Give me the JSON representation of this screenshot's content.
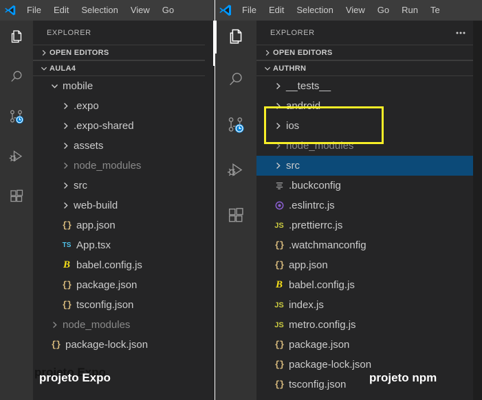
{
  "left_window": {
    "menubar": {
      "logo": "vscode-logo",
      "items": [
        "File",
        "Edit",
        "Selection",
        "View",
        "Go"
      ]
    },
    "activity_bar": {
      "items": [
        {
          "name": "explorer-icon",
          "label": "Explorer",
          "active": true
        },
        {
          "name": "search-icon",
          "label": "Search",
          "active": false
        },
        {
          "name": "source-control-icon",
          "label": "Source Control",
          "active": false
        },
        {
          "name": "run-debug-icon",
          "label": "Run and Debug",
          "active": false
        },
        {
          "name": "extensions-icon",
          "label": "Extensions",
          "active": false
        }
      ]
    },
    "sidebar": {
      "title": "EXPLORER",
      "open_editors": "OPEN EDITORS",
      "root": "AULA4",
      "tree": [
        {
          "label": "mobile",
          "indent": 1,
          "type": "folder",
          "expanded": true,
          "icon": "chevron-down-icon",
          "dim": false
        },
        {
          "label": ".expo",
          "indent": 2,
          "type": "folder",
          "expanded": false,
          "icon": "chevron-right-icon",
          "dim": false
        },
        {
          "label": ".expo-shared",
          "indent": 2,
          "type": "folder",
          "expanded": false,
          "icon": "chevron-right-icon",
          "dim": false
        },
        {
          "label": "assets",
          "indent": 2,
          "type": "folder",
          "expanded": false,
          "icon": "chevron-right-icon",
          "dim": false
        },
        {
          "label": "node_modules",
          "indent": 2,
          "type": "folder",
          "expanded": false,
          "icon": "chevron-right-icon",
          "dim": true
        },
        {
          "label": "src",
          "indent": 2,
          "type": "folder",
          "expanded": false,
          "icon": "chevron-right-icon",
          "dim": false
        },
        {
          "label": "web-build",
          "indent": 2,
          "type": "folder",
          "expanded": false,
          "icon": "chevron-right-icon",
          "dim": false
        },
        {
          "label": "app.json",
          "indent": 2,
          "type": "file",
          "icon": "json-icon",
          "glyph": "{}",
          "dim": false
        },
        {
          "label": "App.tsx",
          "indent": 2,
          "type": "file",
          "icon": "ts-icon",
          "glyph": "TS",
          "dim": false
        },
        {
          "label": "babel.config.js",
          "indent": 2,
          "type": "file",
          "icon": "babel-icon",
          "glyph": "B",
          "dim": false
        },
        {
          "label": "package.json",
          "indent": 2,
          "type": "file",
          "icon": "json-icon",
          "glyph": "{}",
          "dim": false
        },
        {
          "label": "tsconfig.json",
          "indent": 2,
          "type": "file",
          "icon": "json-icon",
          "glyph": "{}",
          "dim": false
        },
        {
          "label": "node_modules",
          "indent": 1,
          "type": "folder",
          "expanded": false,
          "icon": "chevron-right-icon",
          "dim": true
        },
        {
          "label": "package-lock.json",
          "indent": 1,
          "type": "file",
          "icon": "json-icon",
          "glyph": "{}",
          "dim": false
        }
      ]
    },
    "annotation": "projeto Expo",
    "annotation_ghost": "projeto Expo"
  },
  "right_window": {
    "menubar": {
      "logo": "vscode-logo",
      "items": [
        "File",
        "Edit",
        "Selection",
        "View",
        "Go",
        "Run",
        "Te"
      ]
    },
    "activity_bar": {
      "items": [
        {
          "name": "explorer-icon",
          "label": "Explorer",
          "active": true
        },
        {
          "name": "search-icon",
          "label": "Search",
          "active": false
        },
        {
          "name": "source-control-icon",
          "label": "Source Control",
          "active": false
        },
        {
          "name": "run-debug-icon",
          "label": "Run and Debug",
          "active": false
        },
        {
          "name": "extensions-icon",
          "label": "Extensions",
          "active": false
        }
      ]
    },
    "sidebar": {
      "title": "EXPLORER",
      "more_actions": "more-actions",
      "open_editors": "OPEN EDITORS",
      "root": "AUTHRN",
      "tree": [
        {
          "label": "__tests__",
          "indent": 1,
          "type": "folder",
          "expanded": false,
          "icon": "chevron-right-icon",
          "dim": false,
          "selected": false
        },
        {
          "label": "android",
          "indent": 1,
          "type": "folder",
          "expanded": false,
          "icon": "chevron-right-icon",
          "dim": false,
          "selected": false
        },
        {
          "label": "ios",
          "indent": 1,
          "type": "folder",
          "expanded": false,
          "icon": "chevron-right-icon",
          "dim": false,
          "selected": false
        },
        {
          "label": "node_modules",
          "indent": 1,
          "type": "folder",
          "expanded": false,
          "icon": "chevron-right-icon",
          "dim": true,
          "selected": false
        },
        {
          "label": "src",
          "indent": 1,
          "type": "folder",
          "expanded": false,
          "icon": "chevron-right-icon",
          "dim": false,
          "selected": true
        },
        {
          "label": ".buckconfig",
          "indent": 1,
          "type": "file",
          "icon": "config-lines-icon",
          "glyph": "☰",
          "dim": false
        },
        {
          "label": ".eslintrc.js",
          "indent": 1,
          "type": "file",
          "icon": "eslint-icon",
          "glyph": "◉",
          "dim": false
        },
        {
          "label": ".prettierrc.js",
          "indent": 1,
          "type": "file",
          "icon": "js-icon",
          "glyph": "JS",
          "dim": false
        },
        {
          "label": ".watchmanconfig",
          "indent": 1,
          "type": "file",
          "icon": "json-icon",
          "glyph": "{}",
          "dim": false
        },
        {
          "label": "app.json",
          "indent": 1,
          "type": "file",
          "icon": "json-icon",
          "glyph": "{}",
          "dim": false
        },
        {
          "label": "babel.config.js",
          "indent": 1,
          "type": "file",
          "icon": "babel-icon",
          "glyph": "B",
          "dim": false
        },
        {
          "label": "index.js",
          "indent": 1,
          "type": "file",
          "icon": "js-icon",
          "glyph": "JS",
          "dim": false
        },
        {
          "label": "metro.config.js",
          "indent": 1,
          "type": "file",
          "icon": "js-icon",
          "glyph": "JS",
          "dim": false
        },
        {
          "label": "package.json",
          "indent": 1,
          "type": "file",
          "icon": "json-icon",
          "glyph": "{}",
          "dim": false
        },
        {
          "label": "package-lock.json",
          "indent": 1,
          "type": "file",
          "icon": "json-icon",
          "glyph": "{}",
          "dim": false
        },
        {
          "label": "tsconfig.json",
          "indent": 1,
          "type": "file",
          "icon": "json-icon",
          "glyph": "{}",
          "dim": false
        }
      ]
    },
    "highlight_box": {
      "name": "android-ios-highlight",
      "color": "#f7ee27",
      "covers": [
        "android",
        "ios"
      ]
    },
    "annotation": "projeto npm"
  },
  "colors": {
    "menubar_bg": "#3c3c3c",
    "activitybar_bg": "#333333",
    "sidebar_bg": "#252526",
    "editor_bg": "#1e1e1e",
    "selection_blue": "#0c4a78",
    "highlight_yellow": "#f7ee27",
    "text": "#cccccc",
    "text_dim": "#8a8a8a"
  }
}
